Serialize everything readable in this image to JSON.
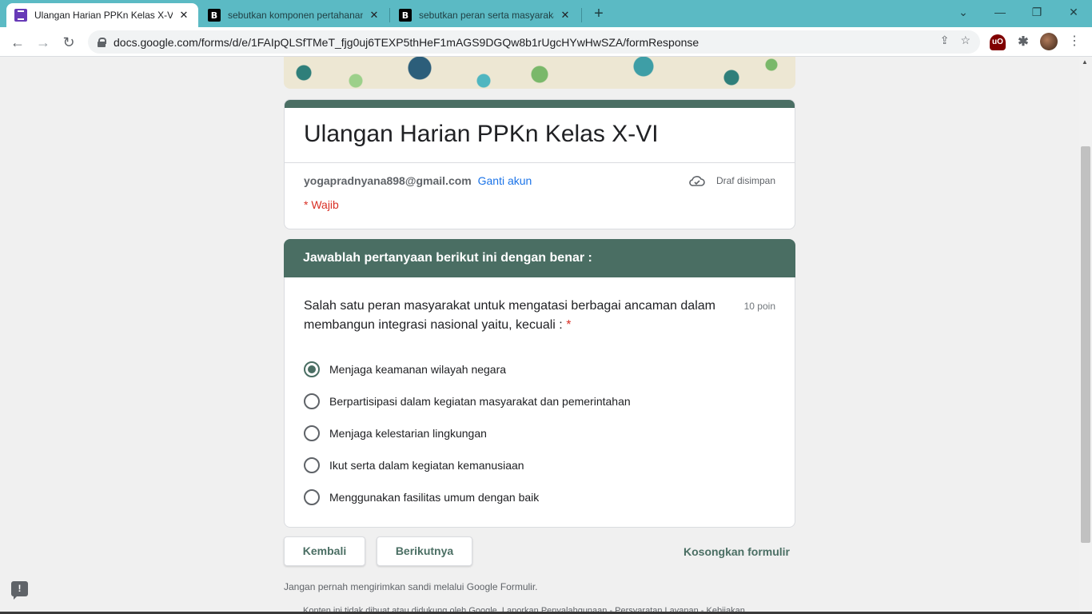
{
  "browser": {
    "tabs": [
      {
        "title": "Ulangan Harian PPKn Kelas X-VI",
        "icon": "forms-icon",
        "close": "✕"
      },
      {
        "title": "sebutkan komponen pertahanan",
        "icon": "B",
        "close": "✕"
      },
      {
        "title": "sebutkan peran serta masyarakat",
        "icon": "B",
        "close": "✕"
      }
    ],
    "new_tab": "+",
    "window_controls": {
      "dropdown": "⌄",
      "minimize": "—",
      "restore": "❐",
      "close": "✕"
    },
    "nav": {
      "back": "←",
      "forward": "→",
      "reload": "↻"
    },
    "url": "docs.google.com/forms/d/e/1FAIpQLSfTMeT_fjg0uj6TEXP5thHeF1mAGS9DGQw8b1rUgcHYwHwSZA/formResponse",
    "omnibox_actions": {
      "share": "⇪",
      "bookmark": "☆"
    },
    "extensions": {
      "ublock": "uO",
      "puzzle": "✱"
    },
    "menu": "⋮"
  },
  "form": {
    "title": "Ulangan Harian PPKn Kelas X-VI",
    "account_email": "yogapradnyana898@gmail.com",
    "switch_account": "Ganti akun",
    "draft_status": "Draf disimpan",
    "required_note": "* Wajib",
    "section_title": "Jawablah pertanyaan berikut ini dengan benar :",
    "question": {
      "text": "Salah satu peran masyarakat untuk mengatasi berbagai ancaman dalam membangun integrasi nasional yaitu, kecuali :",
      "required_mark": "*",
      "points": "10 poin",
      "options": [
        "Menjaga keamanan wilayah negara",
        "Berpartisipasi dalam kegiatan masyarakat dan pemerintahan",
        "Menjaga kelestarian lingkungan",
        "Ikut serta dalam kegiatan kemanusiaan",
        "Menggunakan fasilitas umum dengan baik"
      ],
      "selected_index": 0
    },
    "back_button": "Kembali",
    "next_button": "Berikutnya",
    "clear_form": "Kosongkan formulir",
    "footer_note": "Jangan pernah mengirimkan sandi melalui Google Formulir.",
    "footer_links": "Konten ini tidak dibuat atau didukung oleh Google. Laporkan Penyalahgunaan - Persyaratan Layanan - Kebijakan",
    "feedback_icon": "!"
  },
  "colors": {
    "theme": "#4a6e63",
    "tabbar": "#5bbac4",
    "link": "#1a73e8",
    "required": "#d93025"
  }
}
